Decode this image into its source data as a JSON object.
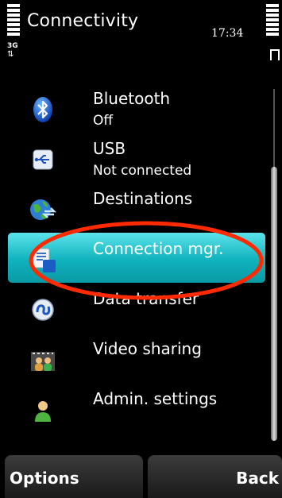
{
  "header": {
    "title": "Connectivity",
    "time": "17:34",
    "network": "3G"
  },
  "menu": {
    "items": [
      {
        "label": "Bluetooth",
        "sub": "Off",
        "icon": "bluetooth-icon"
      },
      {
        "label": "USB",
        "sub": "Not connected",
        "icon": "usb-icon"
      },
      {
        "label": "Destinations",
        "icon": "destinations-icon"
      },
      {
        "label": "Connection mgr.",
        "icon": "connection-manager-icon",
        "selected": true
      },
      {
        "label": "Data transfer",
        "icon": "data-transfer-icon"
      },
      {
        "label": "Video sharing",
        "icon": "video-sharing-icon"
      },
      {
        "label": "Admin. settings",
        "icon": "admin-settings-icon"
      }
    ]
  },
  "softkeys": {
    "left": "Options",
    "right": "Back"
  },
  "colors": {
    "highlight": "#12b4bf",
    "annotation": "#ff2a00"
  }
}
